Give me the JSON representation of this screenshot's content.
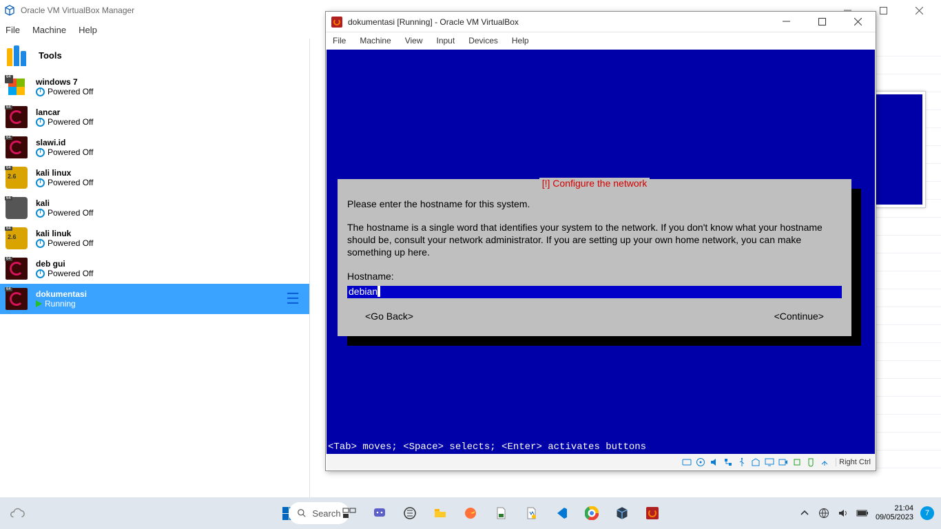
{
  "manager": {
    "title": "Oracle VM VirtualBox Manager",
    "menu": [
      "File",
      "Machine",
      "Help"
    ],
    "tools_label": "Tools",
    "vms": [
      {
        "name": "windows 7",
        "state": "Powered Off",
        "os": "win7"
      },
      {
        "name": "lancar",
        "state": "Powered Off",
        "os": "deb"
      },
      {
        "name": "slawi.id",
        "state": "Powered Off",
        "os": "deb"
      },
      {
        "name": "kali linux",
        "state": "Powered Off",
        "os": "kali-v"
      },
      {
        "name": "kali",
        "state": "Powered Off",
        "os": "kali"
      },
      {
        "name": "kali linuk",
        "state": "Powered Off",
        "os": "kali-v"
      },
      {
        "name": "deb gui",
        "state": "Powered Off",
        "os": "deb"
      },
      {
        "name": "dokumentasi",
        "state": "Running",
        "os": "deb",
        "selected": true
      }
    ],
    "badge_64": "64"
  },
  "vmwin": {
    "title": "dokumentasi [Running] - Oracle VM VirtualBox",
    "menu": [
      "File",
      "Machine",
      "View",
      "Input",
      "Devices",
      "Help"
    ],
    "right_ctrl": "Right Ctrl"
  },
  "installer": {
    "title_prefix": "[!]",
    "title": "Configure the network",
    "prompt": "Please enter the hostname for this system.",
    "explain": "The hostname is a single word that identifies your system to the network. If you don't know what your hostname should be, consult your network administrator. If you are setting up your own home network, you can make something up here.",
    "field_label": "Hostname:",
    "field_value": "debian",
    "go_back": "<Go Back>",
    "continue": "<Continue>",
    "hint": "<Tab> moves; <Space> selects; <Enter> activates buttons"
  },
  "taskbar": {
    "search_label": "Search",
    "time": "21:04",
    "date": "09/05/2023",
    "notif_count": "7"
  }
}
